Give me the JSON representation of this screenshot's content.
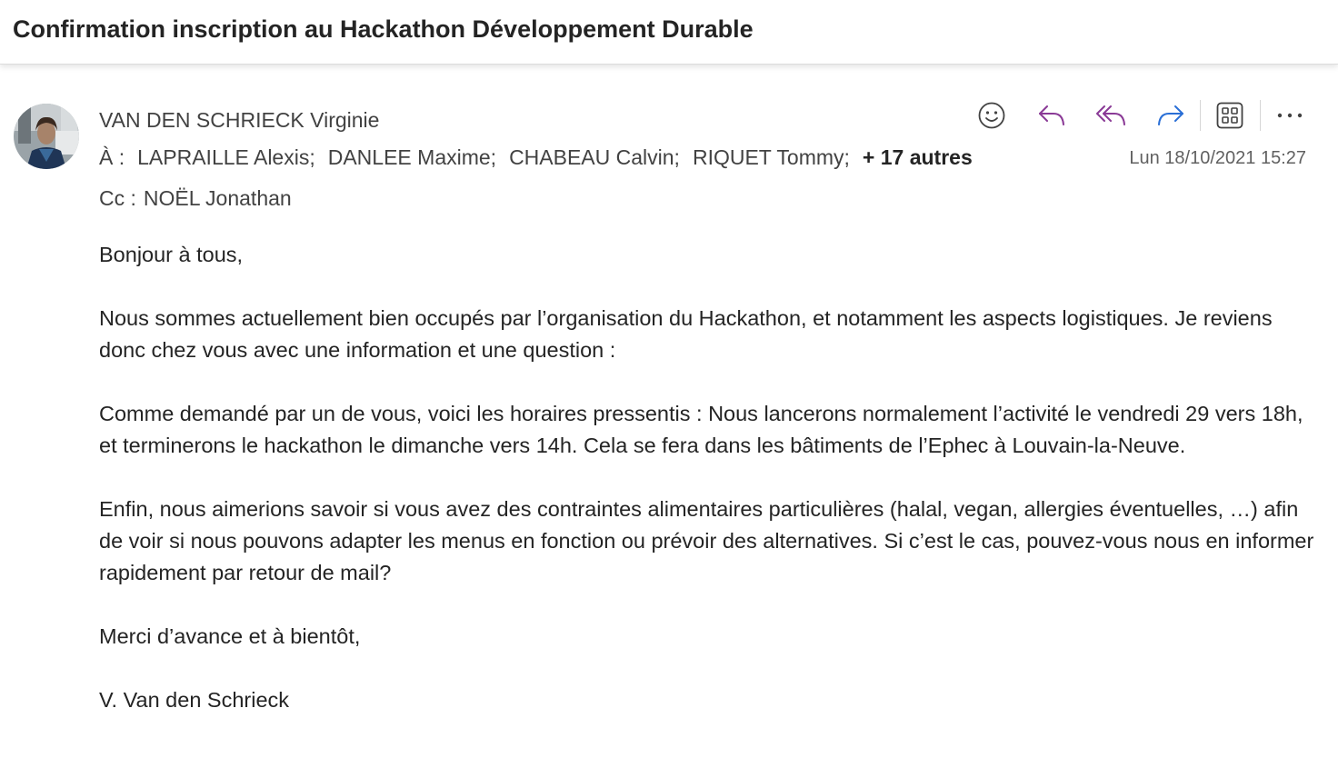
{
  "subject": "Confirmation inscription au Hackathon Développement Durable",
  "sender": {
    "name": "VAN DEN SCHRIECK Virginie"
  },
  "to": {
    "prefix": "À :",
    "recipients": [
      "LAPRAILLE Alexis;",
      "DANLEE Maxime;",
      "CHABEAU Calvin;",
      "RIQUET Tommy;"
    ],
    "more": "+ 17 autres"
  },
  "cc": {
    "prefix": "Cc :",
    "recipients": [
      "NOËL Jonathan"
    ]
  },
  "date": "Lun 18/10/2021 15:27",
  "actions": [
    {
      "name": "emoji-reaction",
      "icon": "smiley-icon"
    },
    {
      "name": "reply",
      "icon": "reply-icon"
    },
    {
      "name": "reply-all",
      "icon": "reply-all-icon"
    },
    {
      "name": "forward",
      "icon": "forward-icon"
    },
    {
      "name": "apps",
      "icon": "apps-grid-icon"
    },
    {
      "name": "more",
      "icon": "more-icon"
    }
  ],
  "colors": {
    "reply": "#8a3a96",
    "forward": "#2a6fd6",
    "icon": "#424242"
  },
  "body": {
    "paragraphs": [
      "Bonjour à tous,",
      "Nous sommes actuellement bien occupés par l’organisation du Hackathon, et notamment les aspects logistiques.  Je reviens donc chez vous avec une information et une question :",
      "Comme demandé par un de vous, voici les horaires pressentis : Nous lancerons normalement l’activité le vendredi 29 vers 18h, et terminerons le hackathon le dimanche vers 14h.  Cela se fera dans les bâtiments de l’Ephec à Louvain-la-Neuve.",
      "Enfin, nous aimerions savoir si vous avez des contraintes alimentaires particulières (halal, vegan, allergies éventuelles, …) afin de voir si nous pouvons adapter les menus en fonction ou prévoir des alternatives.  Si c’est le cas, pouvez-vous nous en informer rapidement par retour de mail?",
      "Merci d’avance et à bientôt,",
      "V. Van den Schrieck"
    ]
  }
}
